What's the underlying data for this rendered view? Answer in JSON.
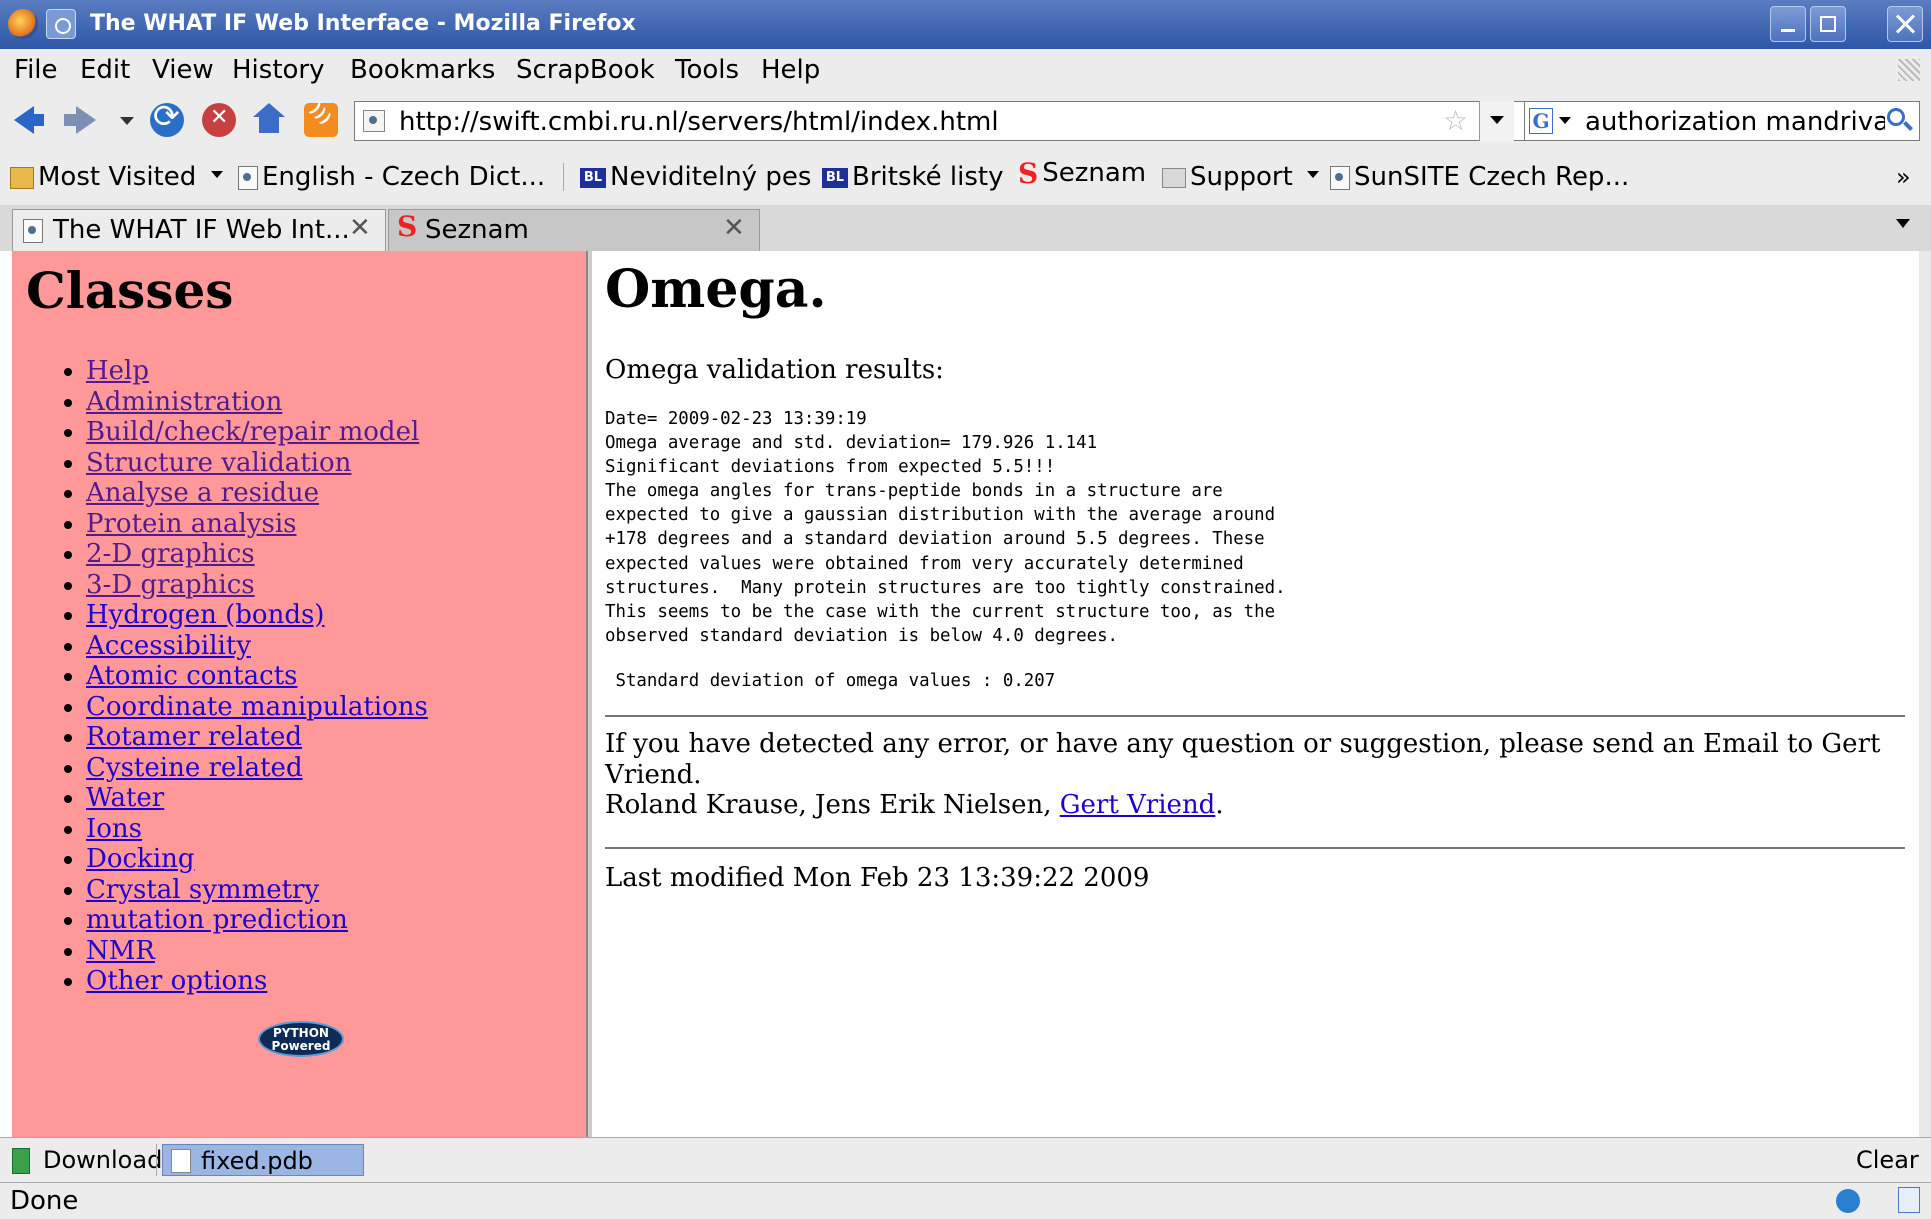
{
  "window": {
    "title": "The WHAT IF Web Interface - Mozilla Firefox"
  },
  "menubar": {
    "items": [
      "File",
      "Edit",
      "View",
      "History",
      "Bookmarks",
      "ScrapBook",
      "Tools",
      "Help"
    ]
  },
  "navbar": {
    "url": "http://swift.cmbi.ru.nl/servers/html/index.html",
    "search_engine": "G",
    "search_text": "authorization mandriva"
  },
  "bookmarks": {
    "items": [
      {
        "label": "Most Visited",
        "icon": "folder-star-icon"
      },
      {
        "label": "English - Czech Dict...",
        "icon": "page-icon"
      },
      {
        "label": "Neviditelný pes",
        "icon": "bl-icon",
        "icon_text": "BL"
      },
      {
        "label": "Britské listy",
        "icon": "bl-icon",
        "icon_text": "BL"
      },
      {
        "label": "Seznam",
        "icon": "seznam-icon",
        "icon_text": "S"
      },
      {
        "label": "Support",
        "icon": "folder-icon"
      },
      {
        "label": "SunSITE Czech Rep...",
        "icon": "page-icon"
      }
    ],
    "more": "»"
  },
  "tabs": [
    {
      "label": "The WHAT IF Web Int...",
      "active": true
    },
    {
      "label": "Seznam",
      "active": false
    }
  ],
  "left": {
    "heading": "Classes",
    "items": [
      "Help",
      "Administration",
      "Build/check/repair model",
      "Structure validation",
      "Analyse a residue",
      "Protein analysis",
      "2-D graphics",
      "3-D graphics",
      "Hydrogen (bonds)",
      "Accessibility",
      "Atomic contacts",
      "Coordinate manipulations",
      "Rotamer related",
      "Cysteine related",
      "Water",
      "Ions",
      "Docking",
      "Crystal symmetry",
      "mutation prediction",
      "NMR",
      "Other options"
    ],
    "badge_line1": "PYTHON",
    "badge_line2": "Powered"
  },
  "main": {
    "heading": "Omega.",
    "subheading": "Omega validation results:",
    "report": "Date= 2009-02-23 13:39:19\nOmega average and std. deviation= 179.926 1.141\nSignificant deviations from expected 5.5!!!\nThe omega angles for trans-peptide bonds in a structure are\nexpected to give a gaussian distribution with the average around\n+178 degrees and a standard deviation around 5.5 degrees. These\nexpected values were obtained from very accurately determined\nstructures.  Many protein structures are too tightly constrained.\nThis seems to be the case with the current structure too, as the\nobserved standard deviation is below 4.0 degrees.",
    "sd_line": " Standard deviation of omega values : 0.207",
    "contact_text": "If you have detected any error, or have any question or suggestion, please send an Email to Gert Vriend.",
    "authors_text": "Roland Krause, Jens Erik Nielsen, ",
    "author_link": "Gert Vriend",
    "authors_end": ".",
    "last_modified": "Last modified Mon Feb 23 13:39:22 2009"
  },
  "downloads": {
    "label": "Downloads",
    "file": "fixed.pdb",
    "clear": "Clear"
  },
  "status": {
    "text": "Done"
  },
  "colors": {
    "left_frame_bg": "#ff9999",
    "link": "#2200cc",
    "visited_link": "#551a8b",
    "titlebar": "#3b63b3"
  }
}
